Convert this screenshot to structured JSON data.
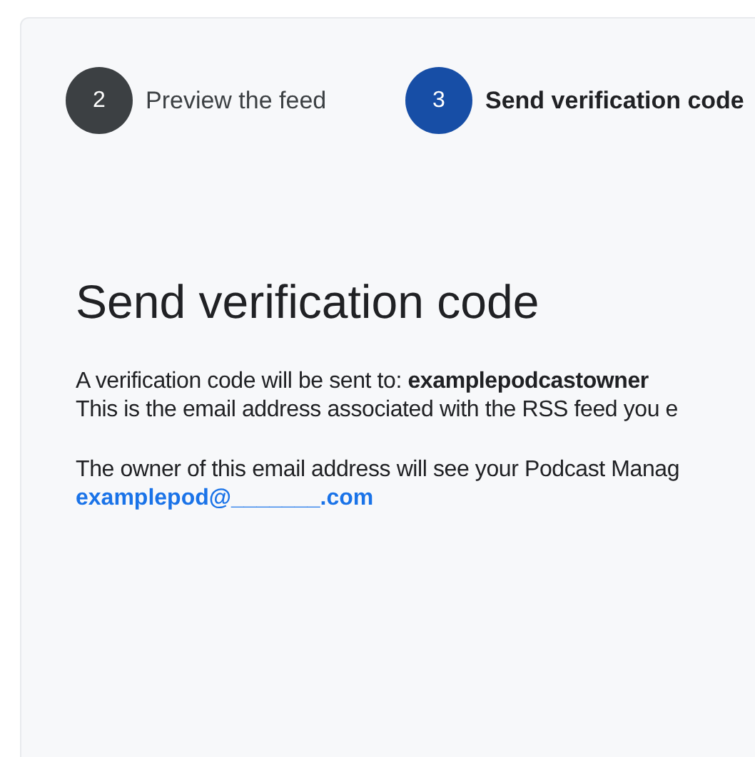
{
  "steps": [
    {
      "number": "2",
      "label": "Preview the feed",
      "selected": false
    },
    {
      "number": "3",
      "label": "Send verification code",
      "selected": true
    }
  ],
  "heading": "Send verification code",
  "paragraphs": [
    [
      "A verification code will be sent to: **examplepodcastowner**",
      "This is the email address associated with the RSS feed you e"
    ],
    [
      "The owner of this email address will see your Podcast Manag"
    ]
  ],
  "email_link": "examplepod@_______.com"
}
